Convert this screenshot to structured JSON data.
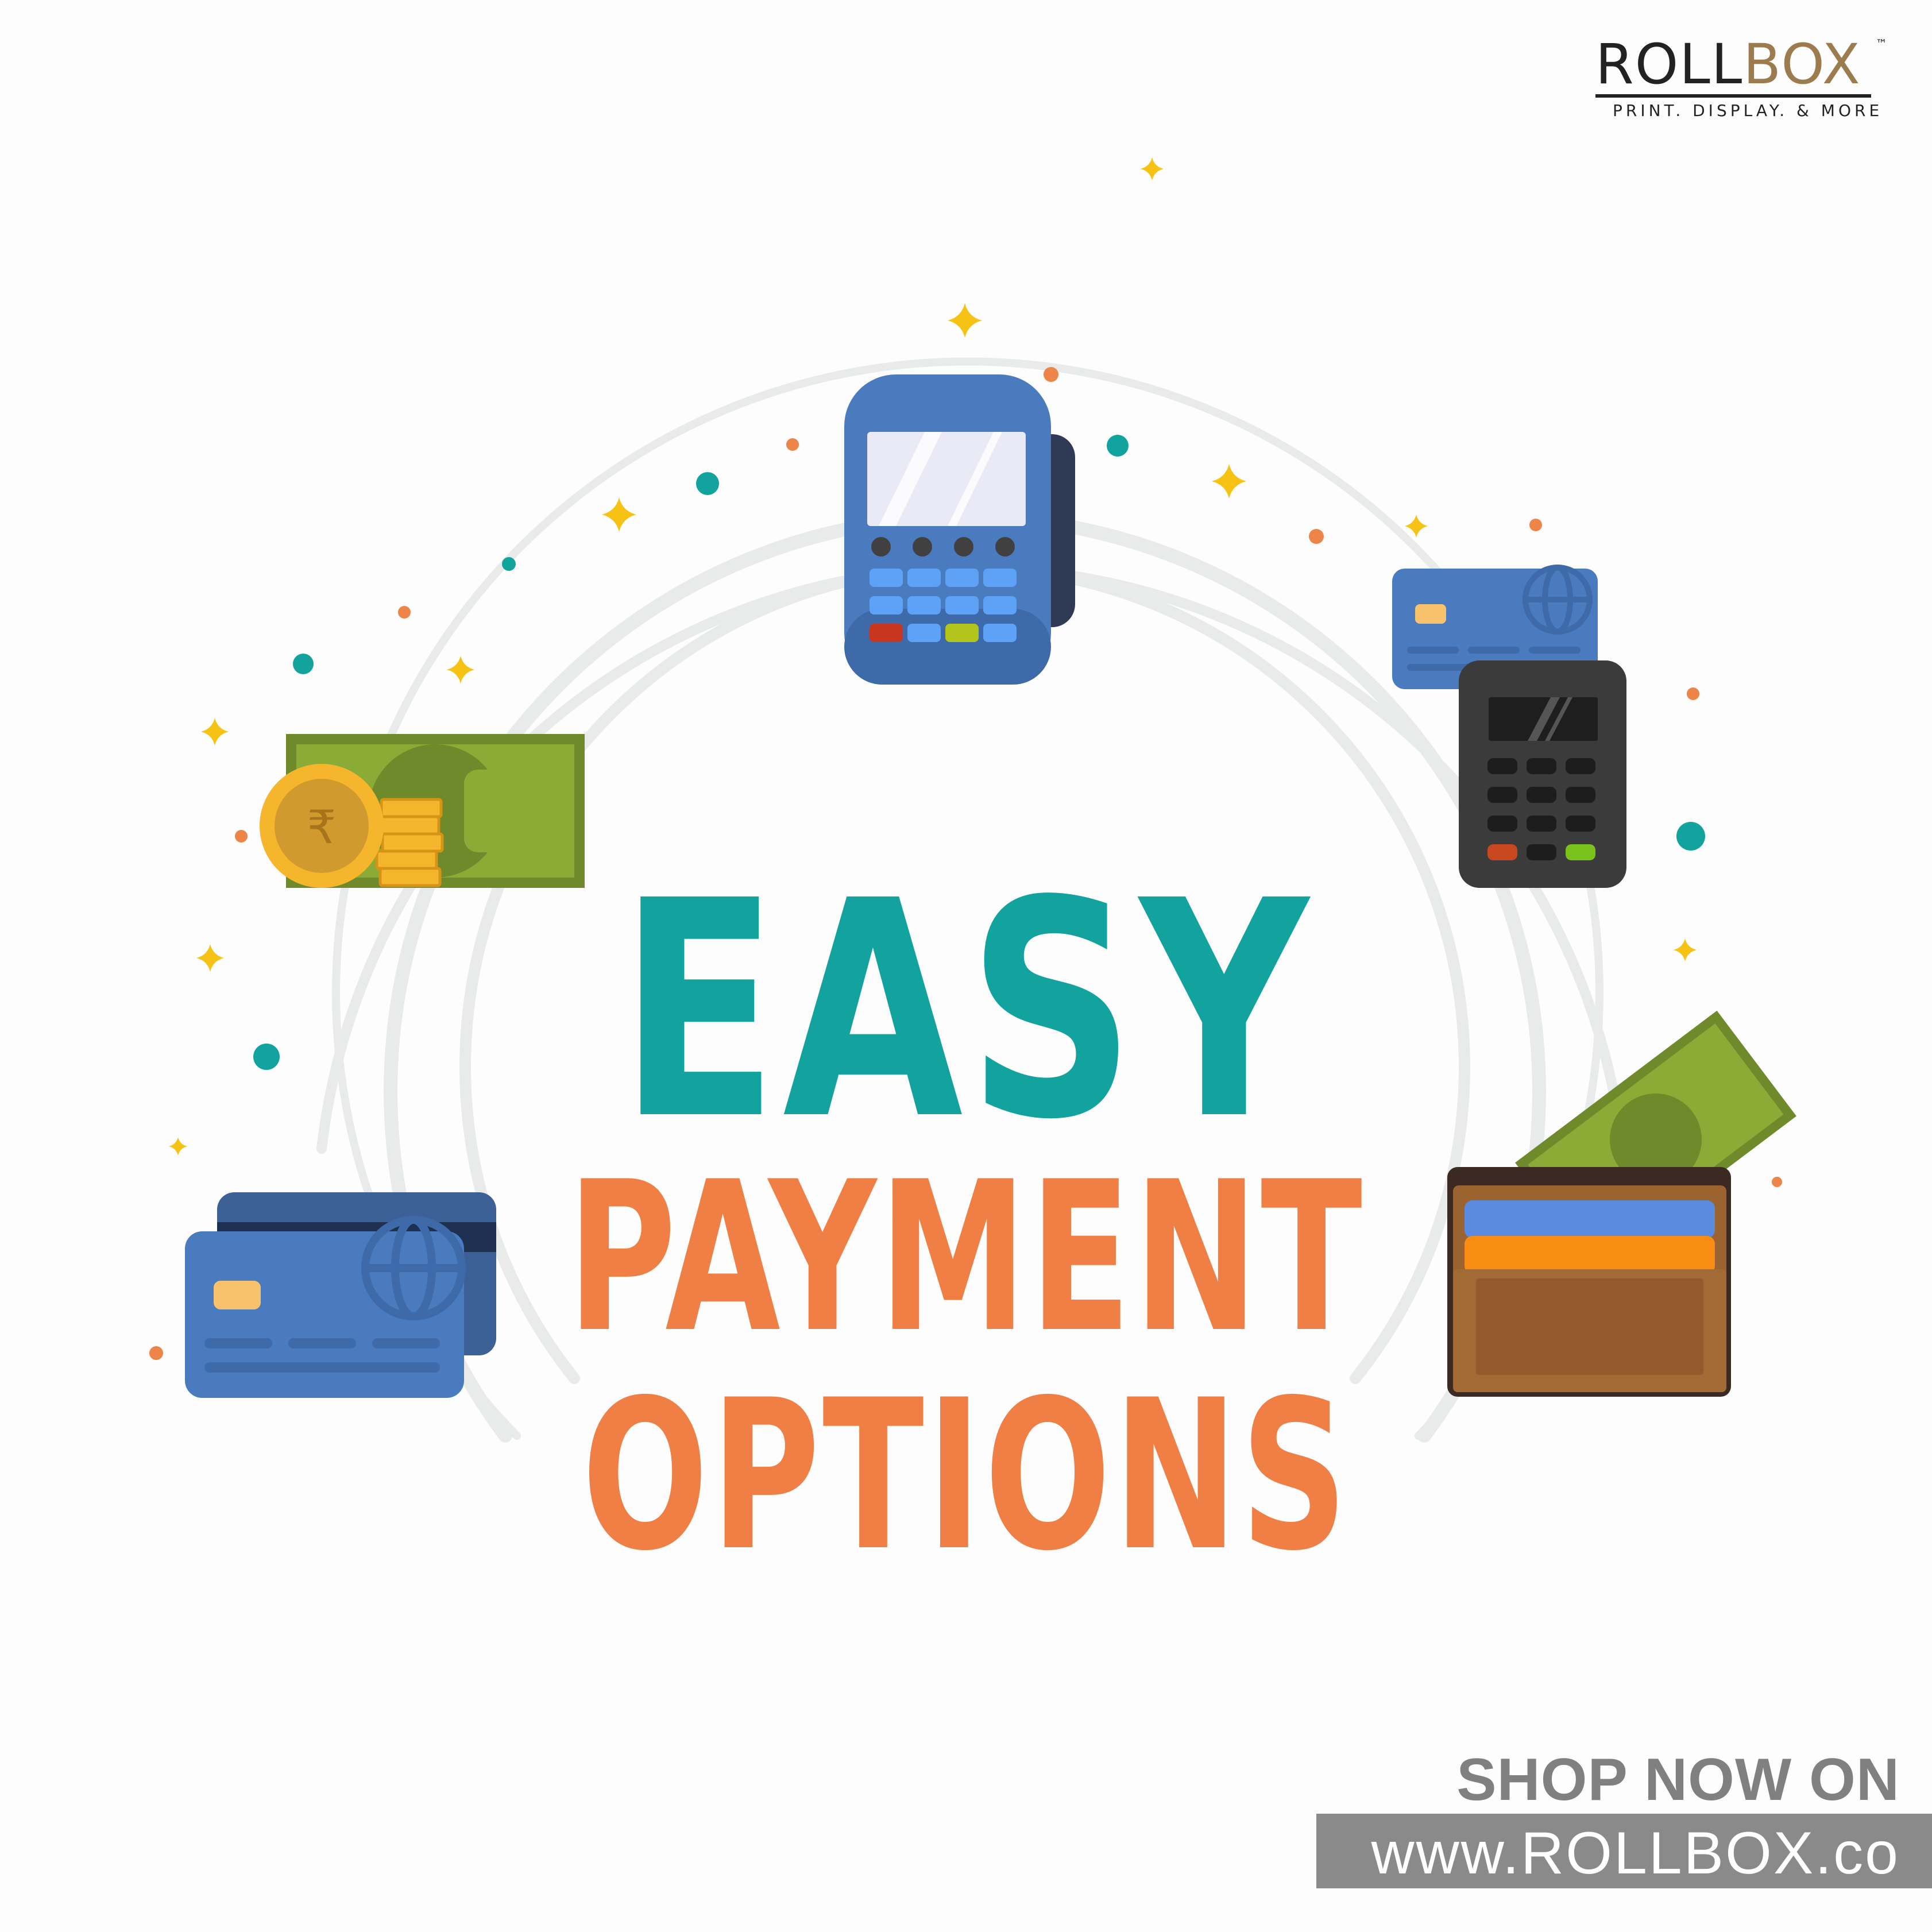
{
  "brand": {
    "logo_primary": "ROLL",
    "logo_secondary": "BOX",
    "trademark": "™",
    "tagline": "PRINT. DISPLAY. & MORE"
  },
  "headline": {
    "line1": "EASY",
    "line2": "PAYMENT",
    "line3": "OPTIONS"
  },
  "cta": {
    "label": "SHOP NOW ON",
    "url": "www.ROLLBOX.co"
  },
  "icons": [
    "card-terminal-icon",
    "card-reader-icon",
    "cash-and-coins-icon",
    "credit-cards-icon",
    "wallet-icon",
    "sparkle-icon"
  ],
  "colors": {
    "teal": "#13a39f",
    "orange": "#ef7f45",
    "blue": "#4a7bbf",
    "gold": "#f5b62d",
    "green": "#8aab35",
    "grey": "#8a8a8a"
  }
}
